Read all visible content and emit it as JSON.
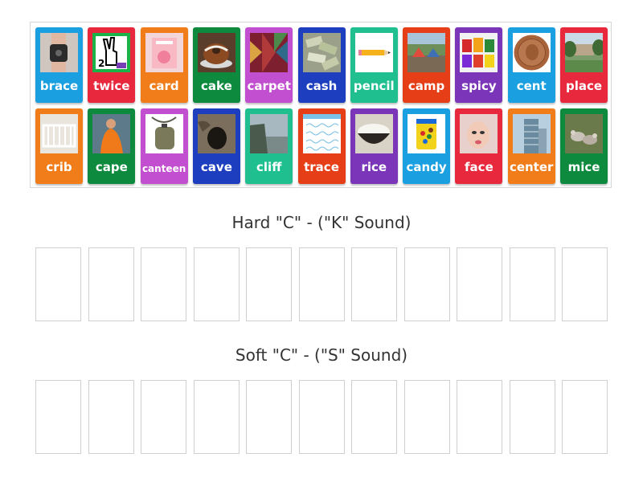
{
  "tiles": [
    {
      "word": "brace",
      "color": "#1a9fe0",
      "icon": "knee-brace-photo"
    },
    {
      "word": "twice",
      "color": "#e8283c",
      "icon": "peace-sign-hand-photo"
    },
    {
      "word": "card",
      "color": "#f07d1a",
      "icon": "greeting-card-photo"
    },
    {
      "word": "cake",
      "color": "#0d8a3e",
      "icon": "bundt-cake-photo"
    },
    {
      "word": "carpet",
      "color": "#c24fcf",
      "icon": "carpet-pattern-photo"
    },
    {
      "word": "cash",
      "color": "#1d3fbf",
      "icon": "cash-pile-photo"
    },
    {
      "word": "pencil",
      "color": "#1fbf8f",
      "icon": "pencil-photo"
    },
    {
      "word": "camp",
      "color": "#e63f17",
      "icon": "campsite-photo"
    },
    {
      "word": "spicy",
      "color": "#7b35b8",
      "icon": "spicy-snacks-photo"
    },
    {
      "word": "cent",
      "color": "#1a9fe0",
      "icon": "penny-coin-photo"
    },
    {
      "word": "place",
      "color": "#e8283c",
      "icon": "park-place-photo"
    },
    {
      "word": "crib",
      "color": "#f07d1a",
      "icon": "crib-photo"
    },
    {
      "word": "cape",
      "color": "#0d8a3e",
      "icon": "orange-cape-photo"
    },
    {
      "word": "canteen",
      "color": "#c24fcf",
      "icon": "canteen-photo"
    },
    {
      "word": "cave",
      "color": "#1d3fbf",
      "icon": "cave-photo"
    },
    {
      "word": "cliff",
      "color": "#1fbf8f",
      "icon": "cliff-photo"
    },
    {
      "word": "trace",
      "color": "#e63f17",
      "icon": "tracing-sheet-photo"
    },
    {
      "word": "rice",
      "color": "#7b35b8",
      "icon": "rice-bowl-photo"
    },
    {
      "word": "candy",
      "color": "#1a9fe0",
      "icon": "candy-jar-photo"
    },
    {
      "word": "face",
      "color": "#e8283c",
      "icon": "face-photo"
    },
    {
      "word": "center",
      "color": "#f07d1a",
      "icon": "building-center-photo"
    },
    {
      "word": "mice",
      "color": "#0d8a3e",
      "icon": "mice-photo"
    }
  ],
  "groups": [
    {
      "title": "Hard \"C\" - (\"K\" Sound)",
      "slot_count": 11
    },
    {
      "title": "Soft \"C\" - (\"S\" Sound)",
      "slot_count": 11
    }
  ]
}
